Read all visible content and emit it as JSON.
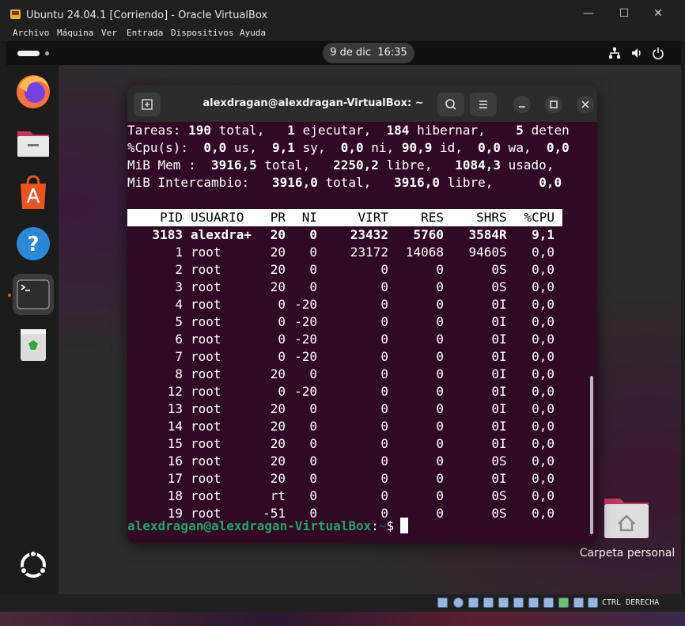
{
  "vb_window": {
    "title": "Ubuntu 24.04.1 [Corriendo] - Oracle VirtualBox",
    "controls": [
      "minimize-icon",
      "maximize-icon",
      "close-icon"
    ],
    "menu": [
      "Archivo",
      "Máquina",
      "Ver",
      "Entrada",
      "Dispositivos",
      "Ayuda"
    ],
    "host_key_label": "CTRL DERECHA"
  },
  "topbar": {
    "clock": "9 de dic  16:35",
    "tray_icons": [
      "network-icon",
      "volume-icon",
      "power-icon"
    ]
  },
  "dock": {
    "items": [
      "firefox-icon",
      "files-icon",
      "app-center-icon",
      "help-icon",
      "terminal-icon",
      "trash-icon"
    ],
    "show_apps_icon": "ubuntu-logo-icon"
  },
  "desktop": {
    "home_label": "Carpeta personal"
  },
  "terminal": {
    "title": "alexdragan@alexdragan-VirtualBox: ~",
    "summary": [
      [
        {
          "t": "Tareas: "
        },
        {
          "t": "190",
          "b": true
        },
        {
          "t": " total,   "
        },
        {
          "t": "1",
          "b": true
        },
        {
          "t": " ejecutar,  "
        },
        {
          "t": "184",
          "b": true
        },
        {
          "t": " hibernar,    "
        },
        {
          "t": "5",
          "b": true
        },
        {
          "t": " deten"
        }
      ],
      [
        {
          "t": "%Cpu(s):  "
        },
        {
          "t": "0,0",
          "b": true
        },
        {
          "t": " us,  "
        },
        {
          "t": "9,1",
          "b": true
        },
        {
          "t": " sy,  "
        },
        {
          "t": "0,0",
          "b": true
        },
        {
          "t": " ni, "
        },
        {
          "t": "90,9",
          "b": true
        },
        {
          "t": " id,  "
        },
        {
          "t": "0,0",
          "b": true
        },
        {
          "t": " wa,  "
        },
        {
          "t": "0,0",
          "b": true
        }
      ],
      [
        {
          "t": "MiB Mem :  "
        },
        {
          "t": "3916,5",
          "b": true
        },
        {
          "t": " total,   "
        },
        {
          "t": "2250,2",
          "b": true
        },
        {
          "t": " libre,   "
        },
        {
          "t": "1084,3",
          "b": true
        },
        {
          "t": " usado,"
        }
      ],
      [
        {
          "t": "MiB Intercambio:   "
        },
        {
          "t": "3916,0",
          "b": true
        },
        {
          "t": " total,   "
        },
        {
          "t": "3916,0",
          "b": true
        },
        {
          "t": " libre,      "
        },
        {
          "t": "0,0",
          "b": true
        }
      ]
    ],
    "columns": [
      "PID",
      "USUARIO",
      "PR",
      "NI",
      "VIRT",
      "RES",
      "SHR",
      "S",
      "%CPU"
    ],
    "processes": [
      [
        "3183",
        "alexdra+",
        "20",
        "0",
        "23432",
        "5760",
        "3584",
        "R",
        "9,1"
      ],
      [
        "1",
        "root",
        "20",
        "0",
        "23172",
        "14068",
        "9460",
        "S",
        "0,0"
      ],
      [
        "2",
        "root",
        "20",
        "0",
        "0",
        "0",
        "0",
        "S",
        "0,0"
      ],
      [
        "3",
        "root",
        "20",
        "0",
        "0",
        "0",
        "0",
        "S",
        "0,0"
      ],
      [
        "4",
        "root",
        "0",
        "-20",
        "0",
        "0",
        "0",
        "I",
        "0,0"
      ],
      [
        "5",
        "root",
        "0",
        "-20",
        "0",
        "0",
        "0",
        "I",
        "0,0"
      ],
      [
        "6",
        "root",
        "0",
        "-20",
        "0",
        "0",
        "0",
        "I",
        "0,0"
      ],
      [
        "7",
        "root",
        "0",
        "-20",
        "0",
        "0",
        "0",
        "I",
        "0,0"
      ],
      [
        "8",
        "root",
        "20",
        "0",
        "0",
        "0",
        "0",
        "I",
        "0,0"
      ],
      [
        "12",
        "root",
        "0",
        "-20",
        "0",
        "0",
        "0",
        "I",
        "0,0"
      ],
      [
        "13",
        "root",
        "20",
        "0",
        "0",
        "0",
        "0",
        "I",
        "0,0"
      ],
      [
        "14",
        "root",
        "20",
        "0",
        "0",
        "0",
        "0",
        "I",
        "0,0"
      ],
      [
        "15",
        "root",
        "20",
        "0",
        "0",
        "0",
        "0",
        "I",
        "0,0"
      ],
      [
        "16",
        "root",
        "20",
        "0",
        "0",
        "0",
        "0",
        "S",
        "0,0"
      ],
      [
        "17",
        "root",
        "20",
        "0",
        "0",
        "0",
        "0",
        "I",
        "0,0"
      ],
      [
        "18",
        "root",
        "rt",
        "0",
        "0",
        "0",
        "0",
        "S",
        "0,0"
      ],
      [
        "19",
        "root",
        "-51",
        "0",
        "0",
        "0",
        "0",
        "S",
        "0,0"
      ]
    ],
    "prompt_user": "alexdragan@alexdragan-VirtualBox",
    "prompt_sep": ":",
    "prompt_path": "~",
    "prompt_char": "$"
  },
  "colors": {
    "terminal_bg": "#300a24",
    "prompt_green": "#26a269",
    "prompt_blue": "#12488b",
    "accent_orange": "#e8541c"
  }
}
